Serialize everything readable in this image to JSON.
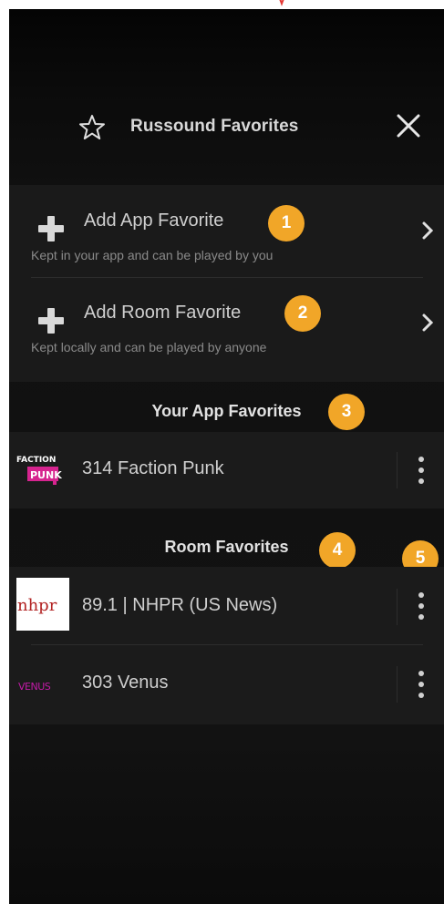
{
  "header": {
    "title": "Russound Favorites",
    "star_icon": "star-outline-icon",
    "close_icon": "close-icon"
  },
  "add_section": {
    "items": [
      {
        "label": "Add App Favorite",
        "sublabel": "Kept in your app and can be played by you",
        "icon": "plus-icon",
        "chevron": "chevron-right-icon"
      },
      {
        "label": "Add Room Favorite",
        "sublabel": "Kept locally and can be played by anyone",
        "icon": "plus-icon",
        "chevron": "chevron-right-icon"
      }
    ]
  },
  "app_favorites": {
    "heading": "Your App Favorites",
    "items": [
      {
        "logo_text_top": "FACTION",
        "logo_text_bottom": "PUNK",
        "number": "314",
        "name": "Faction Punk"
      }
    ]
  },
  "room_favorites": {
    "heading": "Room Favorites",
    "items": [
      {
        "logo_text": "nhpr",
        "number": "89.1",
        "name": "| NHPR (US News)"
      },
      {
        "logo_text": "VENUS",
        "number": "303",
        "name": "Venus"
      }
    ]
  },
  "badges": [
    "1",
    "2",
    "3",
    "4",
    "5"
  ],
  "colors": {
    "badge": "#f1a628",
    "background": "#121212",
    "row": "#1b1b1b",
    "text": "#cfcfcf",
    "subtext": "#8a8a8a",
    "annotation_red": "#e53935",
    "nhpr_red": "#b22222",
    "faction_pink": "#d6248f"
  }
}
